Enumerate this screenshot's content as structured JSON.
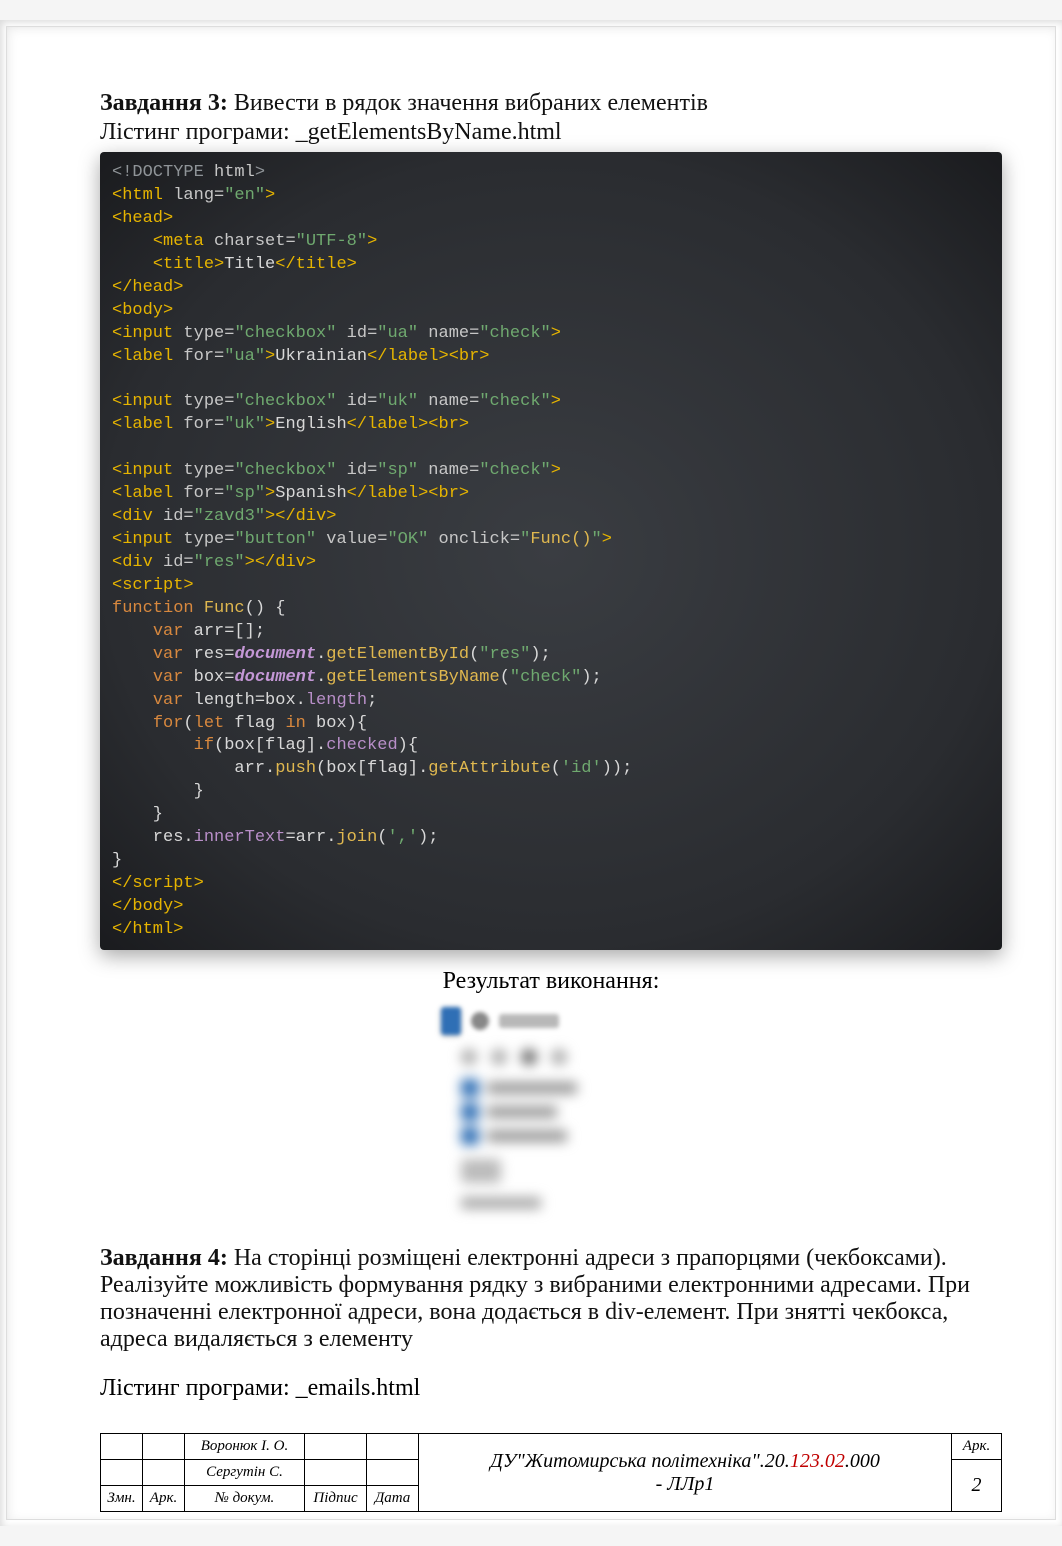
{
  "task3": {
    "heading_label": "Завдання 3:",
    "heading_text": "Вивести в рядок значення вибраних елементів",
    "listing_label": "Лістинг програми:",
    "listing_file": "_getElementsByName.html"
  },
  "code": {
    "doctype": "<!DOCTYPE html>",
    "html_open": "<html lang=\"en\">",
    "head_open": "<head>",
    "meta": "    <meta charset=\"UTF-8\">",
    "title_open": "    <title>",
    "title_text": "Title",
    "title_close": "</title>",
    "head_close": "</head>",
    "body_open": "<body>",
    "input_ua": "<input type=\"checkbox\" id=\"ua\" name=\"check\">",
    "label_ua_open": "<label for=\"ua\">",
    "label_ua_text": "Ukrainian",
    "label_ua_close": "</label><br>",
    "input_uk": "<input type=\"checkbox\" id=\"uk\" name=\"check\">",
    "label_uk_open": "<label for=\"uk\">",
    "label_uk_text": "English",
    "label_uk_close": "</label><br>",
    "input_sp": "<input type=\"checkbox\" id=\"sp\" name=\"check\">",
    "label_sp_open": "<label for=\"sp\">",
    "label_sp_text": "Spanish",
    "label_sp_close": "</label><br>",
    "div_zavd3": "<div id=\"zavd3\"></div>",
    "input_btn": "<input type=\"button\" value=\"OK\" onclick=\"Func()\">",
    "div_res": "<div id=\"res\"></div>",
    "script_open": "<script>",
    "fn_open": "function Func() {",
    "var_arr": "    var arr=[];",
    "var_res": "    var res=document.getElementById(\"res\");",
    "var_box": "    var box=document.getElementsByName(\"check\");",
    "var_len": "    var length=box.length;",
    "for_open": "    for(let flag in box){",
    "if_open": "        if(box[flag].checked){",
    "push_line": "            arr.push(box[flag].getAttribute('id'));",
    "if_close": "        }",
    "for_close": "    }",
    "res_line": "    res.innerText=arr.join(',');",
    "fn_close": "}",
    "script_close_tag": "</script>",
    "body_close": "</body>",
    "html_close": "</html>"
  },
  "result_label": "Результат виконання:",
  "task4": {
    "heading_label": "Завдання 4:",
    "body": "На сторінці розміщені електронні адреси з прапорцями (чекбоксами). Реалізуйте можливість формування рядку з вибраними електронними адресами. При позначенні електронної адреси, вона додається в div-елемент. При знятті чекбокса, адреса видаляється з елементу",
    "listing_label": "Лістинг програми:",
    "listing_file": "_emails.html"
  },
  "stamp": {
    "name1": "Воронюк І. О.",
    "name2": "Сергутін С.",
    "col_zmn": "Змн.",
    "col_ark": "Арк.",
    "col_dokum": "№ докум.",
    "col_pidpys": "Підпис",
    "col_data": "Дата",
    "title_pre": "ДУ\"Житомирська політехніка\".20.",
    "title_red": "123.02",
    "title_post": ".000",
    "title_line2": "- ЛЛр1",
    "ark_label": "Арк.",
    "page_num": "2"
  }
}
